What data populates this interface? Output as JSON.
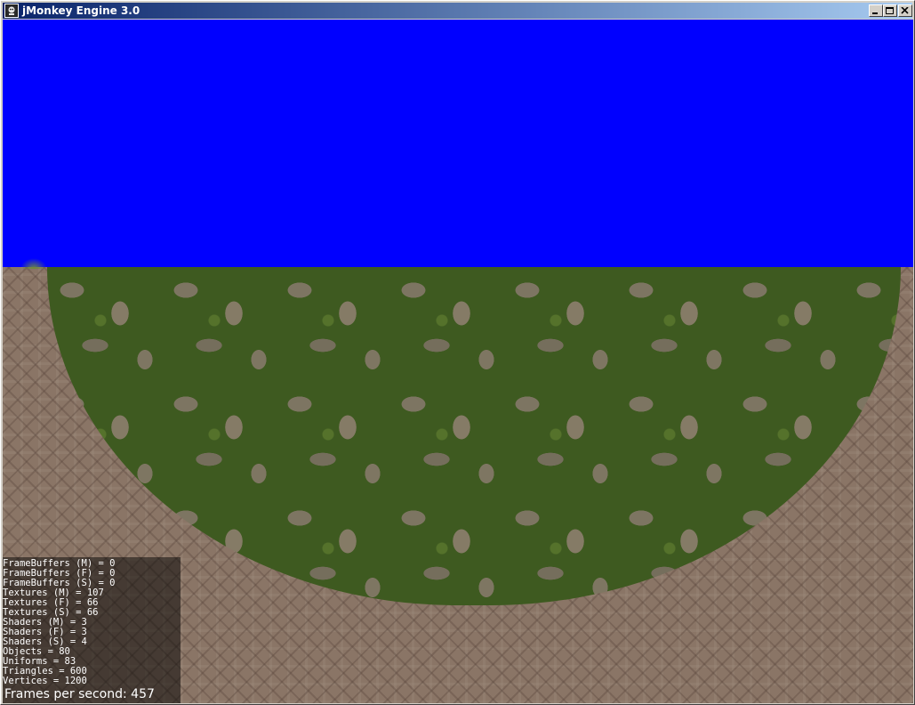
{
  "window": {
    "title": "jMonkey Engine 3.0",
    "icon": "jmonkey-app-icon",
    "controls": {
      "minimize_icon": "minimize-icon",
      "maximize_icon": "maximize-icon",
      "close_icon": "close-icon"
    }
  },
  "scene": {
    "sky_color": "#0000ff",
    "ground_color": "#8a7566",
    "grass_color": "#3e5a20"
  },
  "stats": {
    "lines": [
      "FrameBuffers (M) = 0",
      "FrameBuffers (F) = 0",
      "FrameBuffers (S) = 0",
      "Textures (M) = 107",
      "Textures (F) = 66",
      "Textures (S) = 66",
      "Shaders (M) = 3",
      "Shaders (F) = 3",
      "Shaders (S) = 4",
      "Objects = 80",
      "Uniforms = 83",
      "Triangles = 600",
      "Vertices = 1200"
    ],
    "fps": "Frames per second: 457"
  }
}
